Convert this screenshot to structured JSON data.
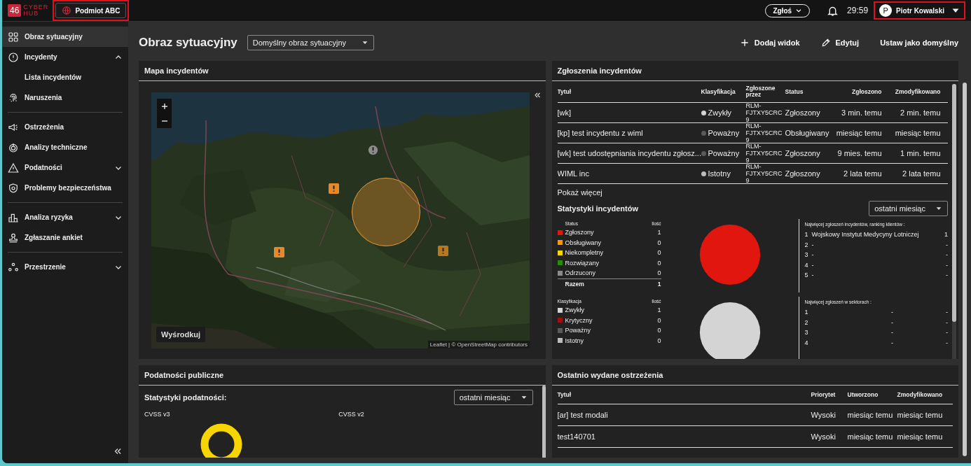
{
  "topbar": {
    "logo": {
      "badge": "46",
      "word_1": "CYBER",
      "word_2": "HUB"
    },
    "entity_button": "Podmiot ABC",
    "report_button": "Zgłoś",
    "timer": "29:59",
    "user": {
      "initial": "P",
      "name": "Piotr Kowalski"
    }
  },
  "sidebar": {
    "sections": [
      [
        {
          "label": "Obraz sytuacyjny",
          "selected": true
        },
        {
          "label": "Incydenty",
          "selected": false,
          "expanded": true,
          "children": [
            {
              "label": "Lista incydentów",
              "selected": false
            }
          ]
        },
        {
          "label": "Naruszenia",
          "selected": false
        }
      ],
      [
        {
          "label": "Ostrzeżenia",
          "selected": false
        },
        {
          "label": "Analizy techniczne",
          "selected": false
        },
        {
          "label": "Podatności",
          "selected": false,
          "expanded": false
        },
        {
          "label": "Problemy bezpieczeństwa",
          "selected": false
        }
      ],
      [
        {
          "label": "Analiza ryzyka",
          "selected": false,
          "expanded": false
        },
        {
          "label": "Zgłaszanie ankiet",
          "selected": false
        }
      ],
      [
        {
          "label": "Przestrzenie",
          "selected": false,
          "expanded": false
        }
      ]
    ]
  },
  "header": {
    "title": "Obraz sytuacyjny",
    "view_select": "Domyślny obraz sytuacyjny",
    "actions": [
      "Dodaj widok",
      "Edytuj",
      "Ustaw jako domyślny"
    ]
  },
  "map_panel": {
    "title": "Mapa incydentów",
    "center_button": "Wyśrodkuj",
    "attribution": "Leaflet | © OpenStreetMap contributors"
  },
  "incidents_panel": {
    "title": "Zgłoszenia incydentów",
    "columns": [
      "Tytuł",
      "Klasyfikacja",
      "Zgłoszone przez",
      "Status",
      "Zgłoszono",
      "Zmodyfikowano"
    ],
    "rows": [
      {
        "title": "[wk]",
        "classification": "Zwykły",
        "color": "#d4d4d4",
        "reported_by": "RLM-FJTXY5CRC9",
        "status": "Zgłoszony",
        "reported": "3 min. temu",
        "modified": "2 min. temu"
      },
      {
        "title": "[kp] test incydentu z wiml",
        "classification": "Poważny",
        "color": "#5a5a5a",
        "reported_by": "RLM-FJTXY5CRC9",
        "status": "Obsługiwany",
        "reported": "miesiąc temu",
        "modified": "miesiąc temu"
      },
      {
        "title": "[wk] test udostępniania incydentu zgłosz...",
        "classification": "Poważny",
        "color": "#5a5a5a",
        "reported_by": "RLM-FJTXY5CRC9",
        "status": "Zgłoszony",
        "reported": "9 mies. temu",
        "modified": "1 min. temu"
      },
      {
        "title": "WIML inc",
        "classification": "Istotny",
        "color": "#bdbdbd",
        "reported_by": "RLM-FJTXY5CRC9",
        "status": "Zgłoszony",
        "reported": "2 lata temu",
        "modified": "2 lata temu"
      }
    ],
    "more_link": "Pokaż więcej",
    "stats": {
      "title": "Statystyki incydentów",
      "period": "ostatni miesiąc",
      "groups": [
        {
          "heading": "Status",
          "count_heading": "Ilość",
          "items": [
            {
              "label": "Zgłoszony",
              "count": "1",
              "color": "#e0160f"
            },
            {
              "label": "Obsługiwany",
              "count": "0",
              "color": "#f59a00"
            },
            {
              "label": "Niekompletny",
              "count": "0",
              "color": "#f5d800"
            },
            {
              "label": "Rozwiązany",
              "count": "0",
              "color": "#2a8a0a"
            },
            {
              "label": "Odrzucony",
              "count": "0",
              "color": "#8a8a8a"
            }
          ],
          "total_label": "Razem",
          "total": "1",
          "ranking": {
            "title": "Najwięcej zgłoszeń incydentów, ranking klientów :",
            "rows": [
              {
                "rank": "1",
                "name": "Wojskowy Instytut Medycyny Lotniczej",
                "count": "1"
              },
              {
                "rank": "2",
                "name": "-",
                "count": "-"
              },
              {
                "rank": "3",
                "name": "-",
                "count": "-"
              },
              {
                "rank": "4",
                "name": "-",
                "count": "-"
              },
              {
                "rank": "5",
                "name": "-",
                "count": "-"
              }
            ]
          }
        },
        {
          "heading": "Klasyfikacja",
          "count_heading": "Ilość",
          "items": [
            {
              "label": "Zwykły",
              "count": "1",
              "color": "#d4d4d4"
            },
            {
              "label": "Krytyczny",
              "count": "0",
              "color": "#9b1010"
            },
            {
              "label": "Poważny",
              "count": "0",
              "color": "#5a5a5a"
            },
            {
              "label": "Istotny",
              "count": "0",
              "color": "#bdbdbd"
            }
          ],
          "ranking": {
            "title": "Najwięcej zgłoszeń w sektorach :",
            "rows": [
              {
                "rank": "1",
                "name": "-",
                "count": "-"
              },
              {
                "rank": "2",
                "name": "-",
                "count": "-"
              },
              {
                "rank": "3",
                "name": "-",
                "count": "-"
              },
              {
                "rank": "4",
                "name": "-",
                "count": "-"
              }
            ]
          }
        }
      ]
    }
  },
  "vulnerabilities_panel": {
    "title": "Podatności publiczne",
    "stats_title": "Statystyki podatności:",
    "period": "ostatni miesiąc",
    "charts": [
      "CVSS v3",
      "CVSS v2"
    ]
  },
  "warnings_panel": {
    "title": "Ostatnio wydane ostrzeżenia",
    "columns": [
      "Tytuł",
      "Priorytet",
      "Utworzono",
      "Zmodyfikowano"
    ],
    "rows": [
      {
        "title": "[ar] test modali",
        "priority": "Wysoki",
        "created": "miesiąc temu",
        "modified": "miesiąc temu"
      },
      {
        "title": "test140701",
        "priority": "Wysoki",
        "created": "miesiąc temu",
        "modified": "miesiąc temu"
      }
    ]
  }
}
